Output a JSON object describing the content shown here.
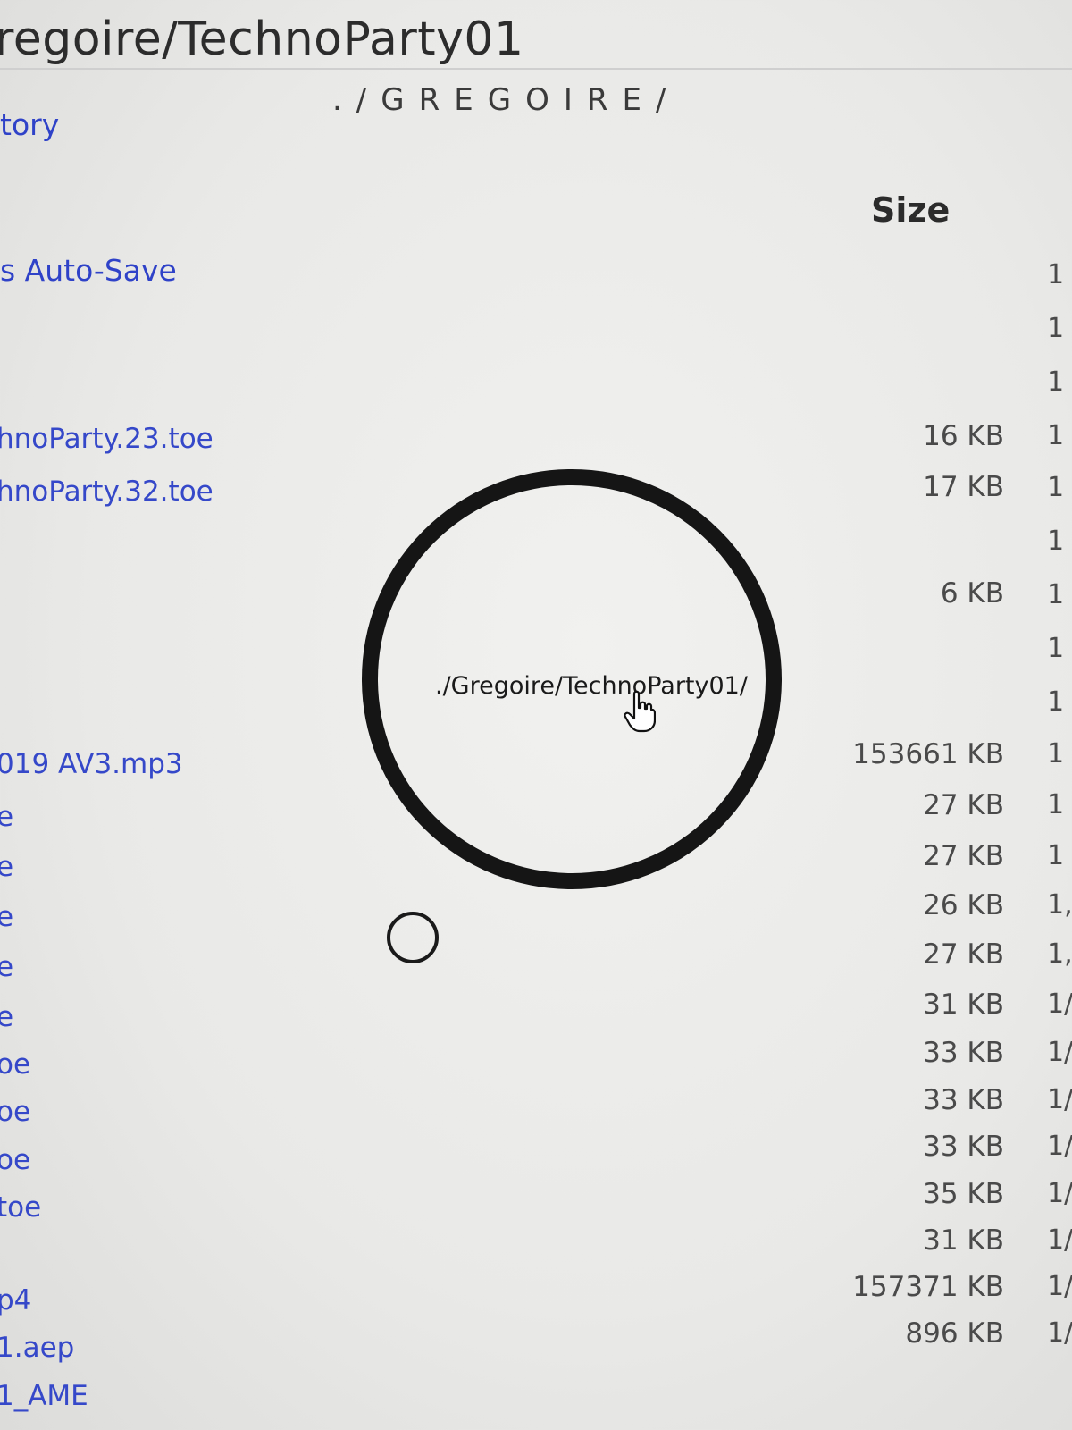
{
  "header": {
    "title": "regoire/TechnoParty01"
  },
  "sidebar": {
    "items": [
      {
        "label": "tory"
      },
      {
        "label": "s Auto-Save"
      }
    ]
  },
  "main": {
    "heading": "./GREGOIRE/"
  },
  "table": {
    "size_header": "Size",
    "rows": [
      {
        "name": "hnoParty.23.toe",
        "size": "16 KB"
      },
      {
        "name": "hnoParty.32.toe",
        "size": "17 KB"
      },
      {
        "name": "",
        "size": "6 KB"
      },
      {
        "name": "019 AV3.mp3",
        "size": "153661 KB"
      },
      {
        "name": "e",
        "size": "27 KB"
      },
      {
        "name": "e",
        "size": "27 KB"
      },
      {
        "name": "e",
        "size": "26 KB"
      },
      {
        "name": "e",
        "size": "27 KB"
      },
      {
        "name": "e",
        "size": "31 KB"
      },
      {
        "name": "oe",
        "size": "33 KB"
      },
      {
        "name": "oe",
        "size": "33 KB"
      },
      {
        "name": "oe",
        "size": "33 KB"
      },
      {
        "name": "toe",
        "size": "35 KB"
      },
      {
        "name": "",
        "size": "31 KB"
      },
      {
        "name": "p4",
        "size": "157371 KB"
      },
      {
        "name": "1.aep",
        "size": "896 KB"
      },
      {
        "name": "1_AME",
        "size": ""
      }
    ],
    "date_fragments": [
      "1",
      "1",
      "1",
      "1",
      "1",
      "1",
      "1",
      "1",
      "1",
      "1",
      "1",
      "1",
      "1,",
      "1,",
      "1/",
      "1/",
      "1/",
      "1/",
      "1/",
      "1/",
      "1/",
      "1/"
    ]
  },
  "overlay": {
    "path_label": "./Gregoire/TechnoParty01/"
  },
  "icons": {
    "cursor": "hand-pointer-icon",
    "ring": "loading-ring-icon",
    "small_ring": "small-circle-icon"
  }
}
